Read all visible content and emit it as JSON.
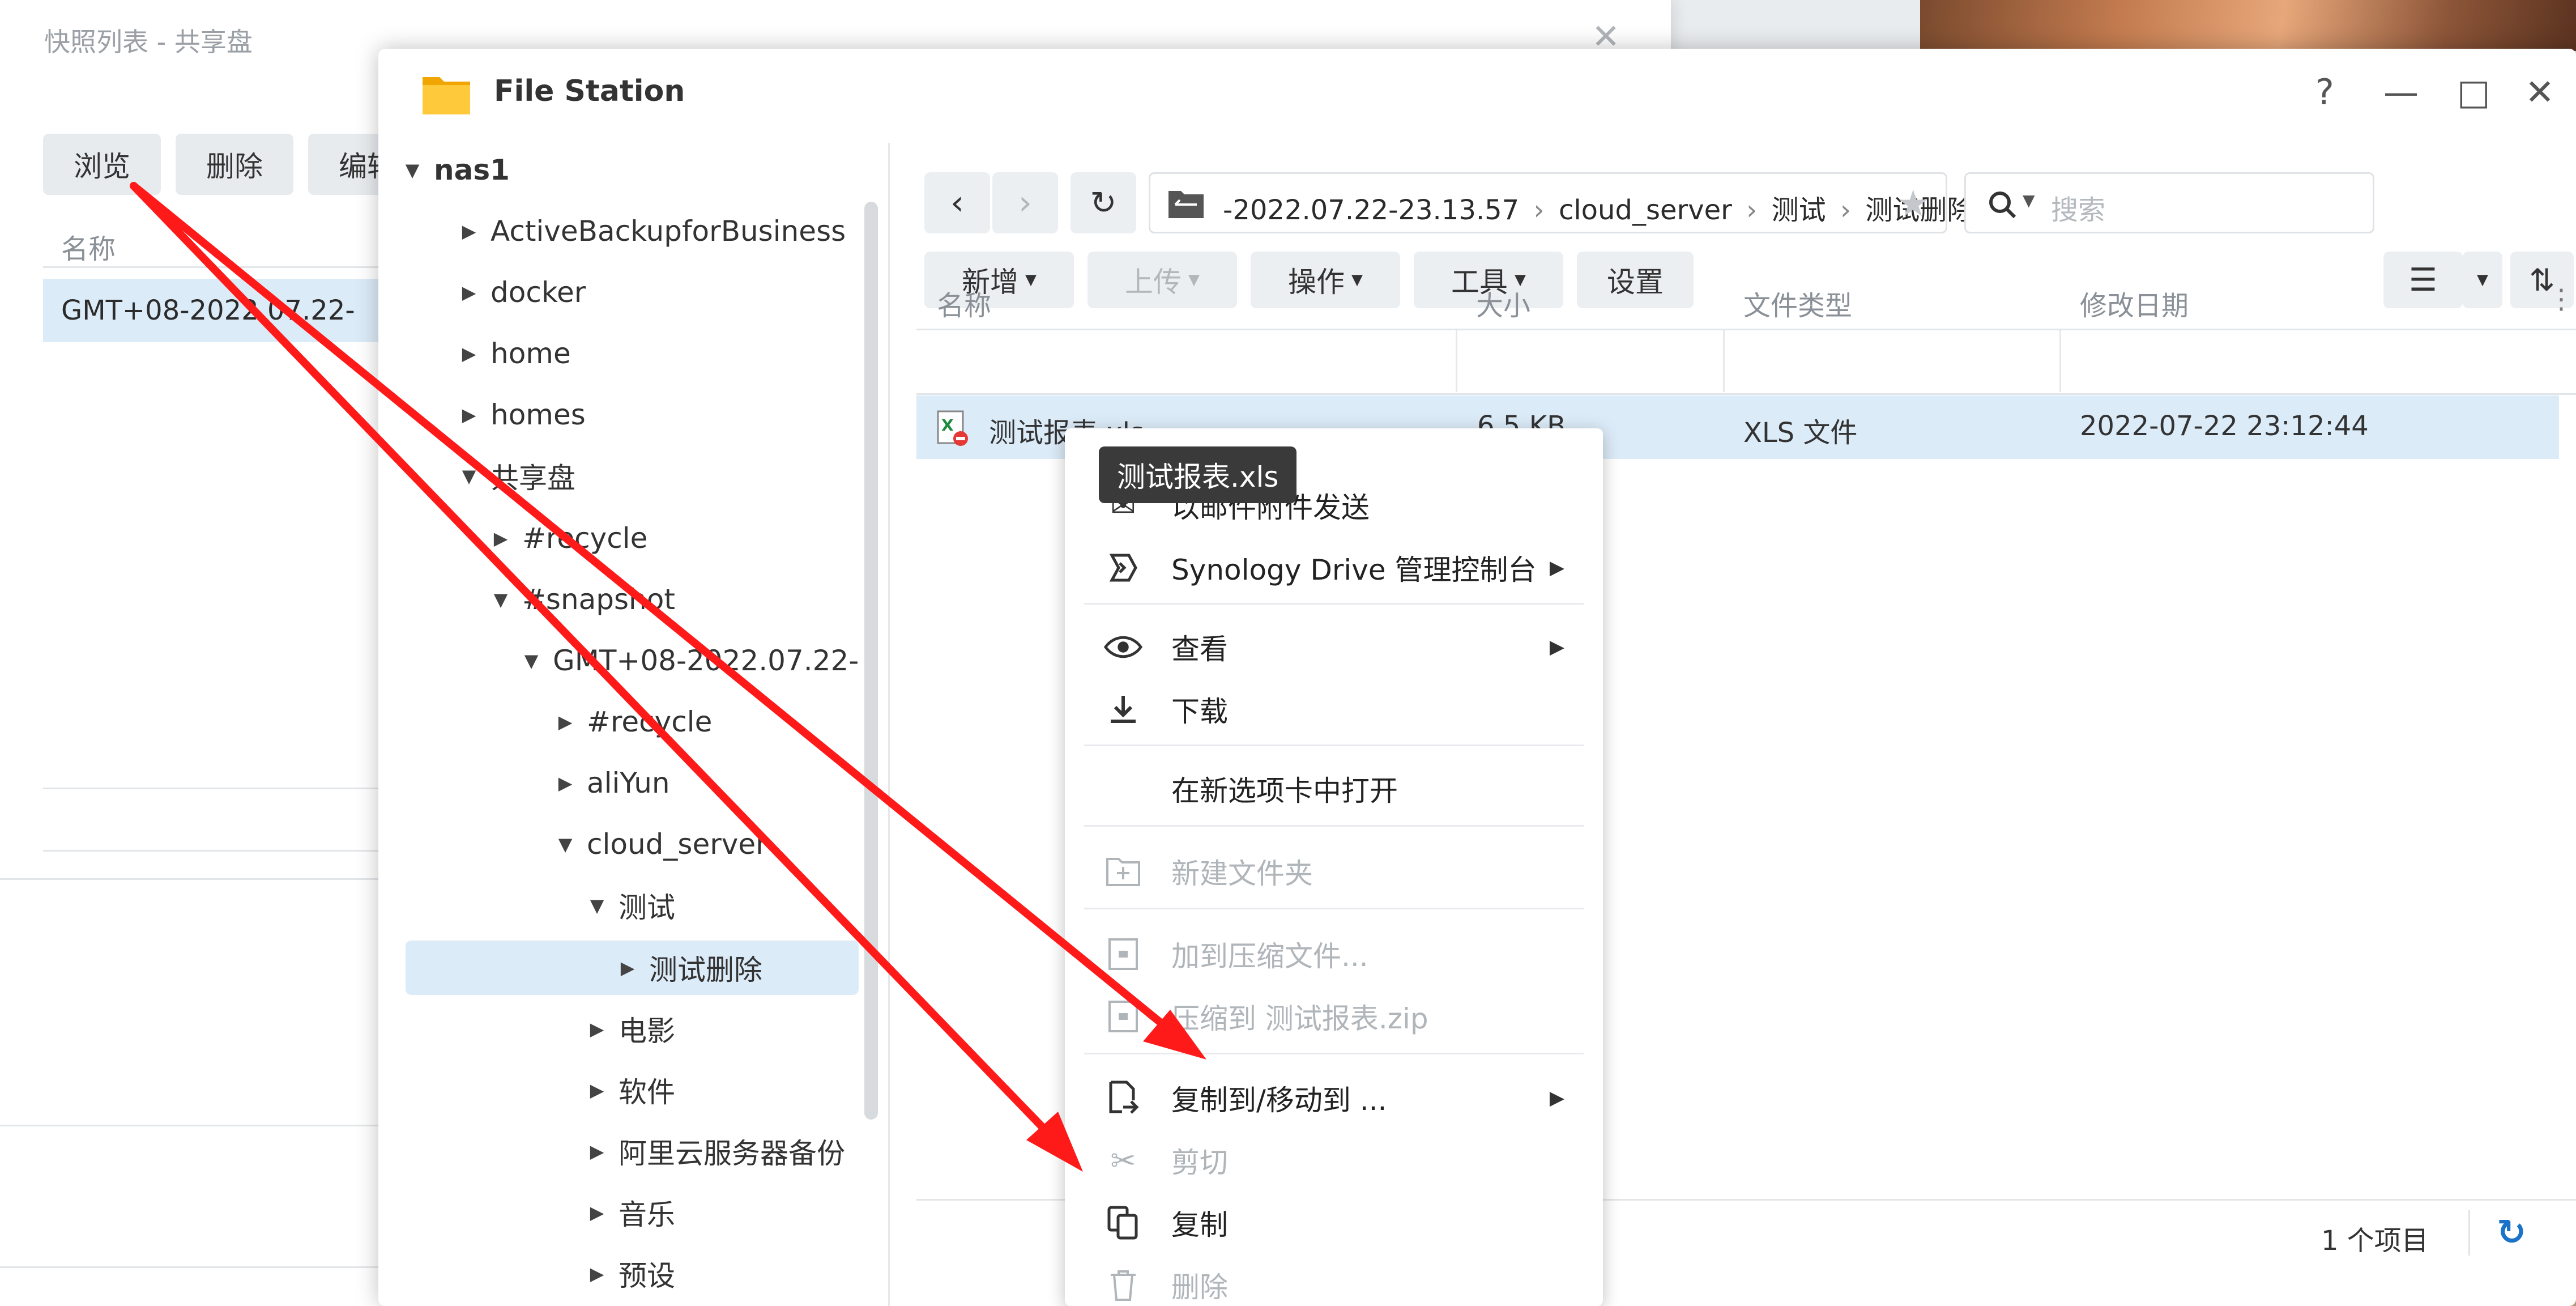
{
  "background_window": {
    "title": "快照列表 - 共享盘",
    "buttons": [
      "浏览",
      "删除",
      "编辑"
    ],
    "column_header": "名称",
    "row": "GMT+08-2022.07.22-"
  },
  "window": {
    "title": "File Station",
    "help": "?",
    "minimize": "—",
    "maximize": "□",
    "close": "✕"
  },
  "sidebar": {
    "items": [
      {
        "label": "nas1",
        "caret": "▼"
      },
      {
        "label": "ActiveBackupforBusiness",
        "caret": "▶"
      },
      {
        "label": "docker",
        "caret": "▶"
      },
      {
        "label": "home",
        "caret": "▶"
      },
      {
        "label": "homes",
        "caret": "▶"
      },
      {
        "label": "共享盘",
        "caret": "▼"
      },
      {
        "label": "#recycle",
        "caret": "▶"
      },
      {
        "label": "#snapshot",
        "caret": "▼"
      },
      {
        "label": "GMT+08-2022.07.22-",
        "caret": "▼"
      },
      {
        "label": "#recycle",
        "caret": "▶"
      },
      {
        "label": "aliYun",
        "caret": "▶"
      },
      {
        "label": "cloud_server",
        "caret": "▼"
      },
      {
        "label": "测试",
        "caret": "▼"
      },
      {
        "label": "测试删除",
        "caret": "▶"
      },
      {
        "label": "电影",
        "caret": "▶"
      },
      {
        "label": "软件",
        "caret": "▶"
      },
      {
        "label": "阿里云服务器备份",
        "caret": "▶"
      },
      {
        "label": "音乐",
        "caret": "▶"
      },
      {
        "label": "预设",
        "caret": "▶"
      }
    ]
  },
  "path": {
    "segments": [
      "-2022.07.22-23.13.57",
      "cloud_server",
      "测试",
      "测试删除"
    ],
    "separator": "›"
  },
  "search": {
    "placeholder": "搜索"
  },
  "toolbar": {
    "new": "新增",
    "upload": "上传",
    "action": "操作",
    "tools": "工具",
    "settings": "设置"
  },
  "columns": {
    "name": "名称",
    "size": "大小",
    "type": "文件类型",
    "modified": "修改日期"
  },
  "file": {
    "name": "测试报表.xls",
    "size": "6.5 KB",
    "type": "XLS 文件",
    "modified": "2022-07-22 23:12:44"
  },
  "tooltip": "测试报表.xls",
  "context_menu": {
    "items": [
      {
        "label": "以邮件附件发送",
        "icon": "mail-icon"
      },
      {
        "label": "Synology Drive 管理控制台",
        "icon": "synology-drive-icon"
      },
      {
        "label": "查看",
        "icon": "eye-icon"
      },
      {
        "label": "下载",
        "icon": "download-icon"
      },
      {
        "label": "在新选项卡中打开",
        "icon": ""
      },
      {
        "label": "新建文件夹",
        "icon": "new-folder-icon"
      },
      {
        "label": "加到压缩文件...",
        "icon": "archive-icon"
      },
      {
        "label": "压缩到 测试报表.zip",
        "icon": "compress-icon"
      },
      {
        "label": "复制到/移动到 ...",
        "icon": "copy-move-icon"
      },
      {
        "label": "剪切",
        "icon": "scissors-icon"
      },
      {
        "label": "复制",
        "icon": "copy-icon"
      },
      {
        "label": "删除",
        "icon": "trash-icon"
      }
    ]
  },
  "status": {
    "count": "1 个项目"
  },
  "colors": {
    "selection": "#dcebf8",
    "arrow": "#ff1a1a",
    "accent": "#1a73c8"
  }
}
